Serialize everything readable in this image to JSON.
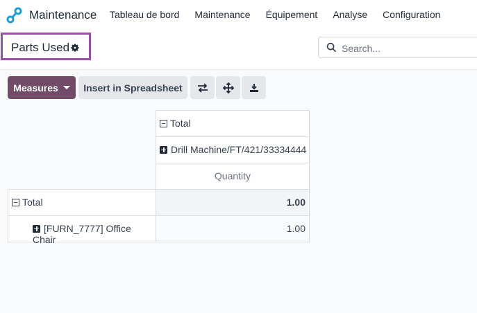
{
  "navbar": {
    "app_name": "Maintenance",
    "menu": [
      "Tableau de bord",
      "Maintenance",
      "Équipement",
      "Analyse",
      "Configuration"
    ]
  },
  "control_panel": {
    "title": "Parts Used",
    "search": {
      "placeholder": "Search...",
      "value": ""
    }
  },
  "toolbar": {
    "measures_label": "Measures",
    "insert_label": "Insert in Spreadsheet",
    "icons": [
      "flip-axis-icon",
      "expand-all-icon",
      "download-icon"
    ]
  },
  "pivot": {
    "col_total_label": "Total",
    "col_group_label": "Drill Machine/FT/421/33334444",
    "measure_label": "Quantity",
    "row_total_label": "Total",
    "row_total_value": "1.00",
    "rows": [
      {
        "label": "[FURN_7777] Office Chair",
        "value": "1.00"
      }
    ]
  },
  "colors": {
    "brand": "#714b67",
    "title_highlight": "#9b4fa8",
    "icon_teal": "#1aa0d9"
  }
}
